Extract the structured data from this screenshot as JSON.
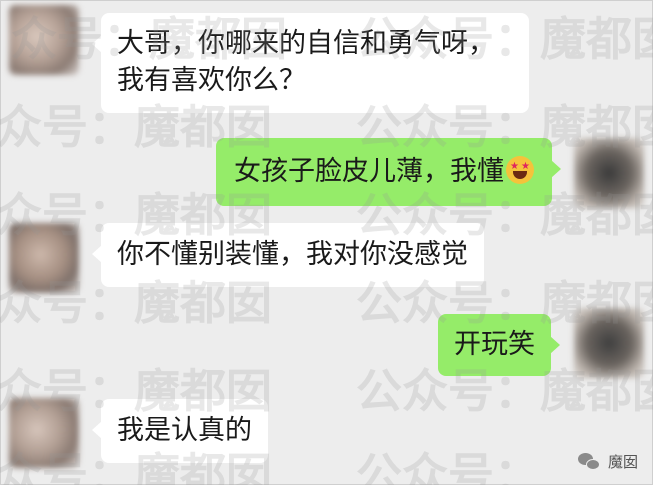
{
  "chat": {
    "messages": [
      {
        "side": "left",
        "text": "大哥，你哪来的自信和勇气呀，我有喜欢你么？"
      },
      {
        "side": "right",
        "text": "女孩子脸皮儿薄，我懂",
        "emoji": "star-struck-emoji"
      },
      {
        "side": "left",
        "text": "你不懂别装懂，我对你没感觉"
      },
      {
        "side": "right",
        "text": "开玩笑"
      },
      {
        "side": "left",
        "text": "我是认真的"
      }
    ]
  },
  "watermark": {
    "text_a": "众号：",
    "text_b": "魔都囡",
    "text_c": "公众号："
  },
  "badge": {
    "label": "魔囡",
    "icon": "wechat-icon"
  },
  "colors": {
    "background": "#ededed",
    "incoming_bubble": "#ffffff",
    "outgoing_bubble": "#95ec69"
  }
}
